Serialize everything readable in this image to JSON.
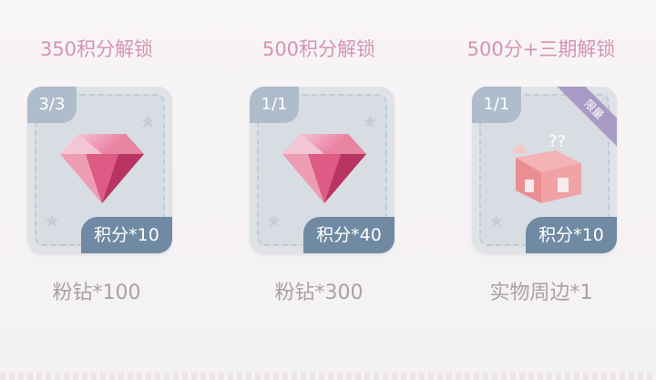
{
  "rewards": [
    {
      "unlock": "350积分解锁",
      "count": "3/3",
      "points": "积分*10",
      "name": "粉钻*100",
      "icon": "pink-diamond-icon",
      "limited": ""
    },
    {
      "unlock": "500积分解锁",
      "count": "1/1",
      "points": "积分*40",
      "name": "粉钻*300",
      "icon": "pink-diamond-icon",
      "limited": ""
    },
    {
      "unlock": "500分+三期解锁",
      "count": "1/1",
      "points": "积分*10",
      "name": "实物周边*1",
      "icon": "mystery-gift-box-icon",
      "limited": "限量"
    }
  ],
  "colors": {
    "unlock_text": "#d493b3",
    "points_tag": "#6f8aa2",
    "count_badge": "#aebccb",
    "limited_ribbon": "#a79ac4",
    "item_name": "#a8a2a8"
  }
}
